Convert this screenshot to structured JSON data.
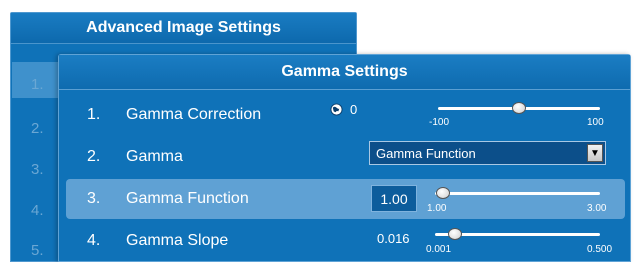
{
  "back_panel": {
    "title": "Advanced Image Settings",
    "numbers": [
      "1.",
      "2.",
      "3.",
      "4.",
      "5."
    ]
  },
  "dialog": {
    "title": "Gamma Settings",
    "rows": [
      {
        "number": "1.",
        "label": "Gamma Correction",
        "value": "0",
        "slider": {
          "min_label": "-100",
          "max_label": "100",
          "min": -100,
          "max": 100,
          "value": 0,
          "position": 0.5
        }
      },
      {
        "number": "2.",
        "label": "Gamma",
        "dropdown_value": "Gamma Function"
      },
      {
        "number": "3.",
        "label": "Gamma Function",
        "value": "1.00",
        "slider": {
          "min_label": "1.00",
          "max_label": "3.00",
          "min": 1.0,
          "max": 3.0,
          "value": 1.0,
          "position": 0.05
        }
      },
      {
        "number": "4.",
        "label": "Gamma Slope",
        "value": "0.016",
        "slider": {
          "min_label": "0.001",
          "max_label": "0.500",
          "min": 0.001,
          "max": 0.5,
          "value": 0.016,
          "position": 0.12
        }
      }
    ]
  },
  "colors": {
    "panel_bg": "#0f72b8",
    "selected_row": "#5fa1d4",
    "text": "#ffffff"
  },
  "icons": {
    "row1_reset": "globe-icon",
    "dropdown": "chevron-down-icon"
  }
}
